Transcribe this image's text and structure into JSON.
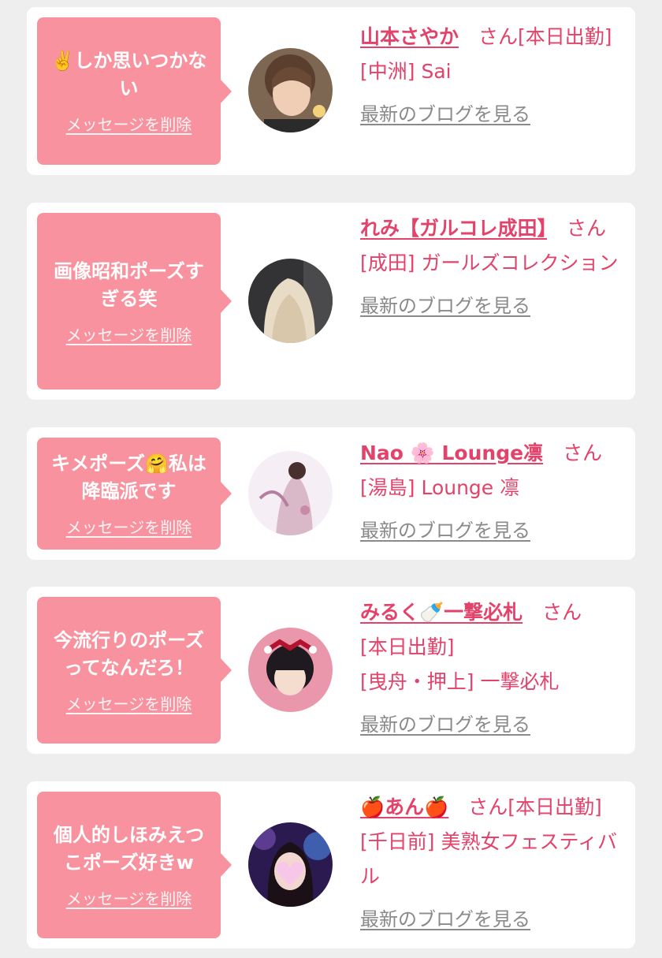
{
  "entries": [
    {
      "message": "✌️しか思いつかない",
      "delete_label": "メッセージを削除",
      "name": "山本さやか",
      "suffix": "　さん[本日出勤]",
      "location": "[中洲] Sai",
      "blog_label": "最新のブログを見る",
      "avatar_bg": "#8a6f5a"
    },
    {
      "message": "画像昭和ポーズすぎる笑",
      "delete_label": "メッセージを削除",
      "name": "れみ【ガルコレ成田】",
      "suffix": "　さん",
      "location": "[成田] ガールズコレクション",
      "blog_label": "最新のブログを見る",
      "avatar_bg": "#3c3c3e"
    },
    {
      "message": "キメポーズ🤗私は降臨派です",
      "delete_label": "メッセージを削除",
      "name": "Nao 🌸 Lounge凛",
      "suffix": "　さん",
      "location": "[湯島] Lounge 凛",
      "blog_label": "最新のブログを見る",
      "avatar_bg": "#f4ecf3"
    },
    {
      "message": "今流行りのポーズってなんだろ！",
      "delete_label": "メッセージを削除",
      "name": "みるく🍼一撃必札",
      "suffix": "　さん",
      "location": "[本日出勤]\n[曳舟・押上] 一撃必札",
      "blog_label": "最新のブログを見る",
      "avatar_bg": "#e98fa6"
    },
    {
      "message": "個人的しほみえつこポーズ好きw",
      "delete_label": "メッセージを削除",
      "name": "🍎あん🍎",
      "suffix": "　さん[本日出勤]",
      "location": "[千日前] 美熟女フェスティバル",
      "blog_label": "最新のブログを見る",
      "avatar_bg": "#2a1a4a"
    }
  ]
}
